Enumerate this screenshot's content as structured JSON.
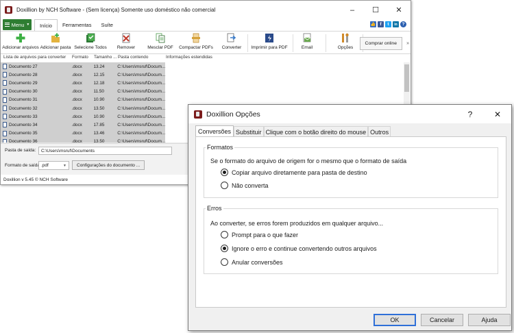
{
  "main_window": {
    "title": "Doxillion by NCH Software - (Sem licença) Somente uso doméstico não comercial",
    "controls": {
      "minimize": "–",
      "maximize": "☐",
      "close": "✕"
    },
    "menu_label": "Menu",
    "tabs": [
      "Início",
      "Ferramentas",
      "Suíte"
    ],
    "social": {
      "like": "👍",
      "facebook": "f",
      "twitter": "t",
      "linkedin": "in",
      "help": "?"
    },
    "toolbar": [
      {
        "label": "Adicionar arquivos",
        "icon": "add-files-icon",
        "color": "#3cb043"
      },
      {
        "label": "Adicionar pasta",
        "icon": "add-folder-icon",
        "color": "#e3b33d"
      },
      {
        "label": "Selecione Todos",
        "icon": "select-all-icon",
        "color": "#2f7d3a"
      },
      {
        "label": "Remover",
        "icon": "remove-icon",
        "color": "#c0392b"
      },
      {
        "label": "Mesclar PDF",
        "icon": "merge-pdf-icon",
        "color": "#4a9a4a"
      },
      {
        "label": "Compactar PDFs",
        "icon": "compress-pdf-icon",
        "color": "#d6a23a"
      },
      {
        "label": "Converter",
        "icon": "convert-icon",
        "color": "#3b7bc8"
      },
      {
        "label": "Imprimir para PDF",
        "icon": "print-pdf-icon",
        "color": "#2a4a8a"
      },
      {
        "label": "Email",
        "icon": "email-icon",
        "color": "#6aa84f"
      },
      {
        "label": "Opções",
        "icon": "options-icon",
        "color": "#d08a2a"
      }
    ],
    "comprar_label": "Comprar online",
    "more_chevron": "»",
    "columns": [
      "Lista de arquivos para converter",
      "Formato",
      "Tamanho ...",
      "Pasta contendo",
      "Informações estendidas"
    ],
    "files": [
      {
        "name": "Documento 27",
        "format": ".docx",
        "size": "13.24",
        "folder": "C:\\Users\\msruf\\Docum..."
      },
      {
        "name": "Documento 28",
        "format": ".docx",
        "size": "12.15",
        "folder": "C:\\Users\\msruf\\Docum..."
      },
      {
        "name": "Documento 29",
        "format": ".docx",
        "size": "12.18",
        "folder": "C:\\Users\\msruf\\Docum..."
      },
      {
        "name": "Documento 30",
        "format": ".docx",
        "size": "11.50",
        "folder": "C:\\Users\\msruf\\Docum..."
      },
      {
        "name": "Documento 31",
        "format": ".docx",
        "size": "10.90",
        "folder": "C:\\Users\\msruf\\Docum..."
      },
      {
        "name": "Documento 32",
        "format": ".docx",
        "size": "13.50",
        "folder": "C:\\Users\\msruf\\Docum..."
      },
      {
        "name": "Documento 33",
        "format": ".docx",
        "size": "10.90",
        "folder": "C:\\Users\\msruf\\Docum..."
      },
      {
        "name": "Documento 34",
        "format": ".docx",
        "size": "17.85",
        "folder": "C:\\Users\\msruf\\Docum..."
      },
      {
        "name": "Documento 35",
        "format": ".docx",
        "size": "13.46",
        "folder": "C:\\Users\\msruf\\Docum..."
      },
      {
        "name": "Documento 36",
        "format": ".docx",
        "size": "13.50",
        "folder": "C:\\Users\\msruf\\Docum..."
      }
    ],
    "output_folder_label": "Pasta de saída:",
    "output_folder_value": "C:\\Users\\msruf\\Documents",
    "output_format_label": "Formato de saída:",
    "output_format_value": ".pdf",
    "document_settings_label": "Configurações do documento ...",
    "status": "Doxillion v 5.45 © NCH Software"
  },
  "dialog": {
    "title": "Doxillion Opções",
    "help": "?",
    "close": "✕",
    "tabs": [
      "Conversões",
      "Substituir",
      "Clique com o botão direito do mouse",
      "Outros"
    ],
    "formatos": {
      "legend": "Formatos",
      "question": "Se o formato do arquivo de origem for o mesmo que o formato de saída",
      "options": [
        "Copiar arquivo diretamente para pasta de destino",
        "Não converta"
      ]
    },
    "erros": {
      "legend": "Erros",
      "question": "Ao converter, se erros forem produzidos em qualquer arquivo...",
      "options": [
        "Prompt para o que fazer",
        "Ignore o erro e continue convertendo outros arquivos",
        "Anular conversões"
      ]
    },
    "buttons": {
      "ok": "OK",
      "cancel": "Cancelar",
      "help": "Ajuda"
    }
  }
}
